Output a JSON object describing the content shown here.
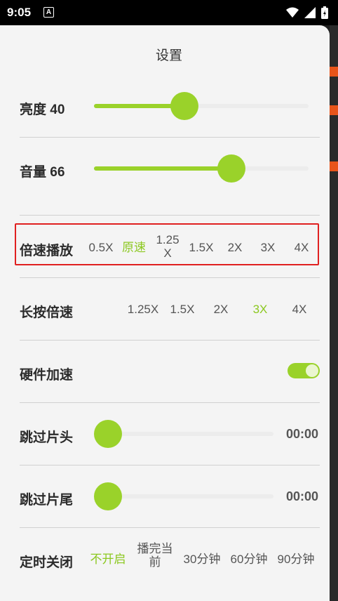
{
  "status_bar": {
    "time": "9:05",
    "notif_letter": "A"
  },
  "title": "设置",
  "brightness": {
    "label": "亮度 40",
    "level_fraction": 0.42
  },
  "volume": {
    "label": "音量 66",
    "level_fraction": 0.64
  },
  "playback_speed": {
    "label": "倍速播放",
    "options": [
      "0.5X",
      "原速",
      "1.25\nX",
      "1.5X",
      "2X",
      "3X",
      "4X"
    ],
    "selected_index": 1
  },
  "long_press_speed": {
    "label": "长按倍速",
    "options": [
      "1.25X",
      "1.5X",
      "2X",
      "3X",
      "4X"
    ],
    "selected_index": 3
  },
  "hardware_accel": {
    "label": "硬件加速",
    "enabled": true
  },
  "skip_intro": {
    "label": "跳过片头",
    "time": "00:00",
    "level_fraction": 0
  },
  "skip_outro": {
    "label": "跳过片尾",
    "time": "00:00",
    "level_fraction": 0
  },
  "sleep_timer": {
    "label": "定时关闭",
    "options": [
      "不开启",
      "播完当\n前",
      "30分钟",
      "60分钟",
      "90分钟"
    ],
    "selected_index": 0
  },
  "colors": {
    "accent": "#9ad22a",
    "highlight_border": "#e02020",
    "background_strip": "#e8541a"
  }
}
